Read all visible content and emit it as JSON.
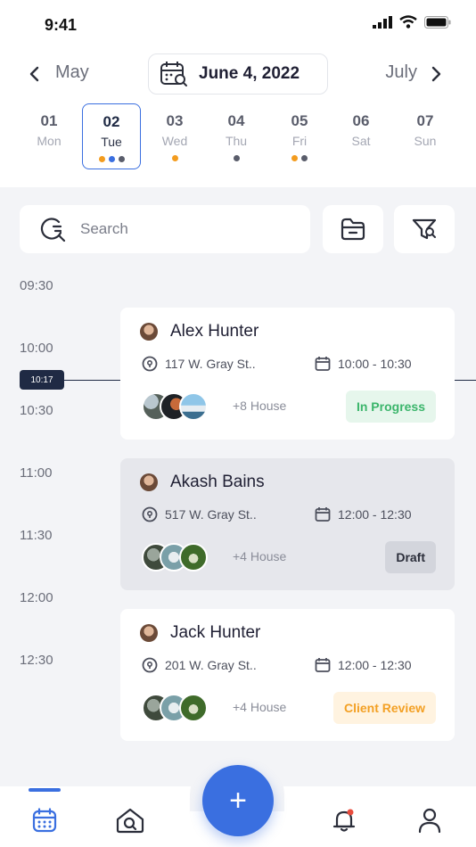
{
  "status_bar": {
    "time": "9:41"
  },
  "month_nav": {
    "prev": "May",
    "current": "June 4, 2022",
    "next": "July"
  },
  "days": [
    {
      "num": "01",
      "name": "Mon",
      "dots": []
    },
    {
      "num": "02",
      "name": "Tue",
      "selected": true,
      "dots": [
        "#f39c1f",
        "#3a6fe0",
        "#5a5d6b"
      ]
    },
    {
      "num": "03",
      "name": "Wed",
      "dots": [
        "#f39c1f"
      ]
    },
    {
      "num": "04",
      "name": "Thu",
      "dots": [
        "#5a5d6b"
      ]
    },
    {
      "num": "05",
      "name": "Fri",
      "dots": [
        "#f39c1f",
        "#5a5d6b"
      ]
    },
    {
      "num": "06",
      "name": "Sat",
      "dots": []
    },
    {
      "num": "07",
      "name": "Sun",
      "dots": []
    }
  ],
  "search": {
    "placeholder": "Search"
  },
  "times": [
    "09:30",
    "10:00",
    "10:30",
    "11:00",
    "11:30",
    "12:00",
    "12:30"
  ],
  "now_marker": "10:17",
  "appointments": [
    {
      "name": "Alex Hunter",
      "address": "117 W. Gray St..",
      "time": "10:00 - 10:30",
      "houses": "+8 House",
      "status": "In Progress",
      "status_bg": "#e6f6ec",
      "status_fg": "#3bb56b"
    },
    {
      "name": "Akash Bains",
      "address": "517 W. Gray St..",
      "time": "12:00 - 12:30",
      "houses": "+4 House",
      "status": "Draft",
      "status_bg": "#d3d5dc",
      "status_fg": "#2b2e3a"
    },
    {
      "name": "Jack Hunter",
      "address": "201 W. Gray St..",
      "time": "12:00 - 12:30",
      "houses": "+4 House",
      "status": "Client Review",
      "status_bg": "#fff3e0",
      "status_fg": "#f3a024"
    }
  ],
  "fab": {
    "label": "+"
  },
  "colors": {
    "accent": "#3a6fe0",
    "background": "#f3f4f7",
    "dark": "#1f2a44"
  },
  "icons": [
    "calendar-icon",
    "search-icon",
    "folder-icon",
    "filter-icon",
    "location-icon",
    "clock-icon",
    "home-search-icon",
    "bell-icon",
    "user-icon"
  ]
}
